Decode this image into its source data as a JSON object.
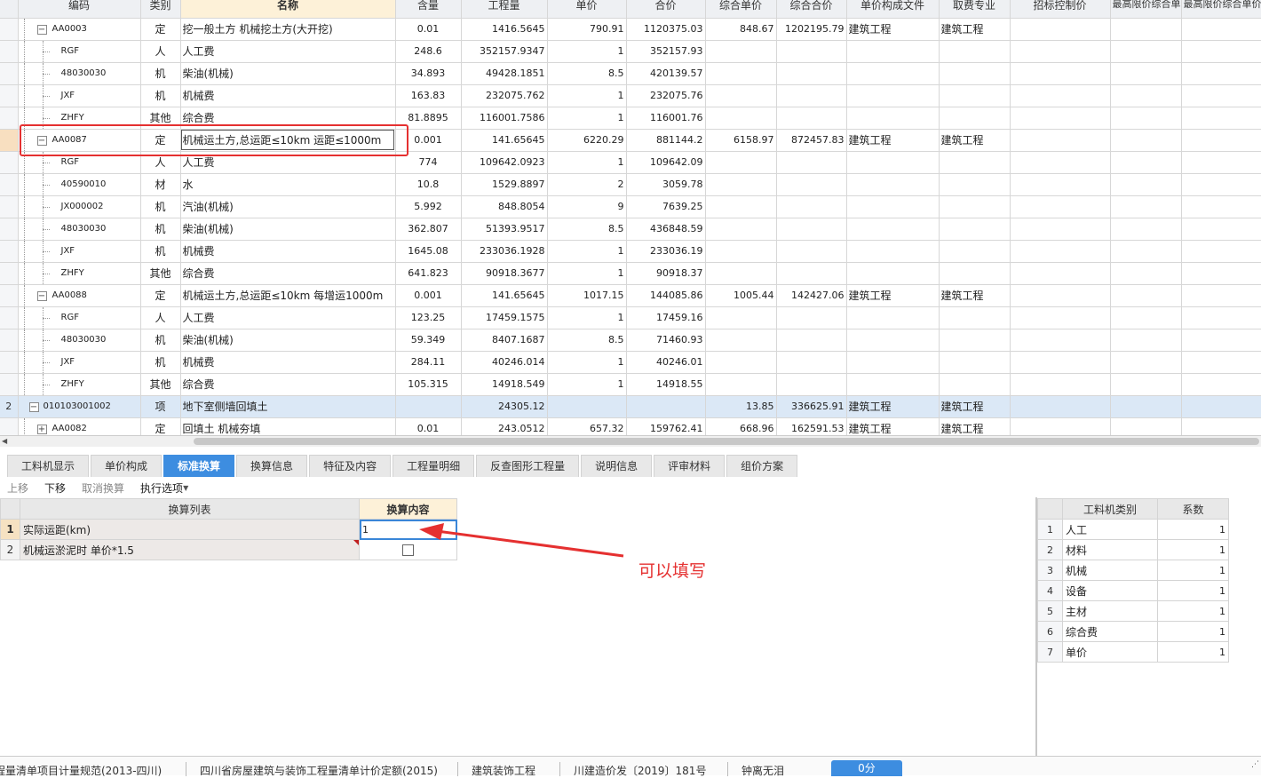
{
  "grid": {
    "headers": [
      "",
      "编码",
      "类别",
      "名称",
      "含量",
      "工程量",
      "单价",
      "合价",
      "综合单价",
      "综合合价",
      "单价构成文件",
      "取费专业",
      "招标控制价",
      "最高限价综合单价",
      "最高限价综合单价"
    ],
    "rows": [
      {
        "rn": "",
        "code": "AA0003",
        "level": 1,
        "toggle": "−",
        "cat": "定",
        "name": "挖一般土方 机械挖土方(大开挖)",
        "qty": "0.01",
        "amount": "1416.5645",
        "price": "790.91",
        "total": "1120375.03",
        "cprice": "848.67",
        "ctotal": "1202195.79",
        "file": "建筑工程",
        "fee": "建筑工程"
      },
      {
        "rn": "",
        "code": "RGF",
        "level": 2,
        "cat": "人",
        "name": "人工费",
        "qty": "248.6",
        "amount": "352157.9347",
        "price": "1",
        "total": "352157.93",
        "cprice": "",
        "ctotal": "",
        "file": "",
        "fee": ""
      },
      {
        "rn": "",
        "code": "48030030",
        "level": 2,
        "cat": "机",
        "name": "柴油(机械)",
        "qty": "34.893",
        "amount": "49428.1851",
        "price": "8.5",
        "total": "420139.57",
        "cprice": "",
        "ctotal": "",
        "file": "",
        "fee": ""
      },
      {
        "rn": "",
        "code": "JXF",
        "level": 2,
        "cat": "机",
        "name": "机械费",
        "qty": "163.83",
        "amount": "232075.762",
        "price": "1",
        "total": "232075.76",
        "cprice": "",
        "ctotal": "",
        "file": "",
        "fee": ""
      },
      {
        "rn": "",
        "code": "ZHFY",
        "level": 2,
        "cat": "其他",
        "name": "综合费",
        "qty": "81.8895",
        "amount": "116001.7586",
        "price": "1",
        "total": "116001.76",
        "cprice": "",
        "ctotal": "",
        "file": "",
        "fee": ""
      },
      {
        "rn": "",
        "code": "AA0087",
        "level": 1,
        "toggle": "−",
        "cat": "定",
        "name": "机械运土方,总运距≤10km 运距≤1000m",
        "qty": "0.001",
        "amount": "141.65645",
        "price": "6220.29",
        "total": "881144.2",
        "cprice": "6158.97",
        "ctotal": "872457.83",
        "file": "建筑工程",
        "fee": "建筑工程",
        "current": true
      },
      {
        "rn": "",
        "code": "RGF",
        "level": 2,
        "cat": "人",
        "name": "人工费",
        "qty": "774",
        "amount": "109642.0923",
        "price": "1",
        "total": "109642.09",
        "cprice": "",
        "ctotal": "",
        "file": "",
        "fee": ""
      },
      {
        "rn": "",
        "code": "40590010",
        "level": 2,
        "cat": "材",
        "name": "水",
        "qty": "10.8",
        "amount": "1529.8897",
        "price": "2",
        "total": "3059.78",
        "cprice": "",
        "ctotal": "",
        "file": "",
        "fee": ""
      },
      {
        "rn": "",
        "code": "JX000002",
        "level": 2,
        "cat": "机",
        "name": "汽油(机械)",
        "qty": "5.992",
        "amount": "848.8054",
        "price": "9",
        "total": "7639.25",
        "cprice": "",
        "ctotal": "",
        "file": "",
        "fee": ""
      },
      {
        "rn": "",
        "code": "48030030",
        "level": 2,
        "cat": "机",
        "name": "柴油(机械)",
        "qty": "362.807",
        "amount": "51393.9517",
        "price": "8.5",
        "total": "436848.59",
        "cprice": "",
        "ctotal": "",
        "file": "",
        "fee": ""
      },
      {
        "rn": "",
        "code": "JXF",
        "level": 2,
        "cat": "机",
        "name": "机械费",
        "qty": "1645.08",
        "amount": "233036.1928",
        "price": "1",
        "total": "233036.19",
        "cprice": "",
        "ctotal": "",
        "file": "",
        "fee": ""
      },
      {
        "rn": "",
        "code": "ZHFY",
        "level": 2,
        "cat": "其他",
        "name": "综合费",
        "qty": "641.823",
        "amount": "90918.3677",
        "price": "1",
        "total": "90918.37",
        "cprice": "",
        "ctotal": "",
        "file": "",
        "fee": ""
      },
      {
        "rn": "",
        "code": "AA0088",
        "level": 1,
        "toggle": "−",
        "cat": "定",
        "name": "机械运土方,总运距≤10km 每增运1000m",
        "qty": "0.001",
        "amount": "141.65645",
        "price": "1017.15",
        "total": "144085.86",
        "cprice": "1005.44",
        "ctotal": "142427.06",
        "file": "建筑工程",
        "fee": "建筑工程"
      },
      {
        "rn": "",
        "code": "RGF",
        "level": 2,
        "cat": "人",
        "name": "人工费",
        "qty": "123.25",
        "amount": "17459.1575",
        "price": "1",
        "total": "17459.16",
        "cprice": "",
        "ctotal": "",
        "file": "",
        "fee": ""
      },
      {
        "rn": "",
        "code": "48030030",
        "level": 2,
        "cat": "机",
        "name": "柴油(机械)",
        "qty": "59.349",
        "amount": "8407.1687",
        "price": "8.5",
        "total": "71460.93",
        "cprice": "",
        "ctotal": "",
        "file": "",
        "fee": ""
      },
      {
        "rn": "",
        "code": "JXF",
        "level": 2,
        "cat": "机",
        "name": "机械费",
        "qty": "284.11",
        "amount": "40246.014",
        "price": "1",
        "total": "40246.01",
        "cprice": "",
        "ctotal": "",
        "file": "",
        "fee": ""
      },
      {
        "rn": "",
        "code": "ZHFY",
        "level": 2,
        "cat": "其他",
        "name": "综合费",
        "qty": "105.315",
        "amount": "14918.549",
        "price": "1",
        "total": "14918.55",
        "cprice": "",
        "ctotal": "",
        "file": "",
        "fee": ""
      },
      {
        "rn": "2",
        "code": "010103001002",
        "level": 0,
        "toggle": "−",
        "cat": "项",
        "name": "地下室侧墙回填土",
        "qty": "",
        "amount": "24305.12",
        "price": "",
        "total": "",
        "cprice": "13.85",
        "ctotal": "336625.91",
        "file": "建筑工程",
        "fee": "建筑工程",
        "section": true
      },
      {
        "rn": "",
        "code": "AA0082",
        "level": 1,
        "toggle": "+",
        "cat": "定",
        "name": "回填土 机械夯填",
        "qty": "0.01",
        "amount": "243.0512",
        "price": "657.32",
        "total": "159762.41",
        "cprice": "668.96",
        "ctotal": "162591.53",
        "file": "建筑工程",
        "fee": "建筑工程"
      }
    ]
  },
  "tabs": [
    "工料机显示",
    "单价构成",
    "标准换算",
    "换算信息",
    "特征及内容",
    "工程量明细",
    "反查图形工程量",
    "说明信息",
    "评审材料",
    "组价方案"
  ],
  "active_tab": "标准换算",
  "toolbar": {
    "up": "上移",
    "down": "下移",
    "cancel": "取消换算",
    "exec": "执行选项"
  },
  "conversion": {
    "header_list": "换算列表",
    "header_content": "换算内容",
    "rows": [
      {
        "no": "1",
        "label": "实际运距(km)",
        "value": "1"
      },
      {
        "no": "2",
        "label": "机械运淤泥时 单价*1.5",
        "checked": false
      }
    ]
  },
  "annotation": {
    "text": "可以填写",
    "color": "#e53030"
  },
  "coefficients": {
    "header_type": "工料机类别",
    "header_coef": "系数",
    "rows": [
      {
        "no": "1",
        "type": "人工",
        "coef": "1"
      },
      {
        "no": "2",
        "type": "材料",
        "coef": "1"
      },
      {
        "no": "3",
        "type": "机械",
        "coef": "1"
      },
      {
        "no": "4",
        "type": "设备",
        "coef": "1"
      },
      {
        "no": "5",
        "type": "主材",
        "coef": "1"
      },
      {
        "no": "6",
        "type": "综合费",
        "coef": "1"
      },
      {
        "no": "7",
        "type": "单价",
        "coef": "1"
      }
    ]
  },
  "status": {
    "items": [
      "程量清单项目计量规范(2013-四川)",
      "四川省房屋建筑与装饰工程量清单计价定额(2015)",
      "建筑装饰工程",
      "川建造价发〔2019〕181号",
      "钟离无泪"
    ],
    "timer": "0分"
  },
  "colors": {
    "accent": "#3d8de0",
    "highlight_box": "#e53030",
    "selected_row": "#dbe8f6"
  }
}
